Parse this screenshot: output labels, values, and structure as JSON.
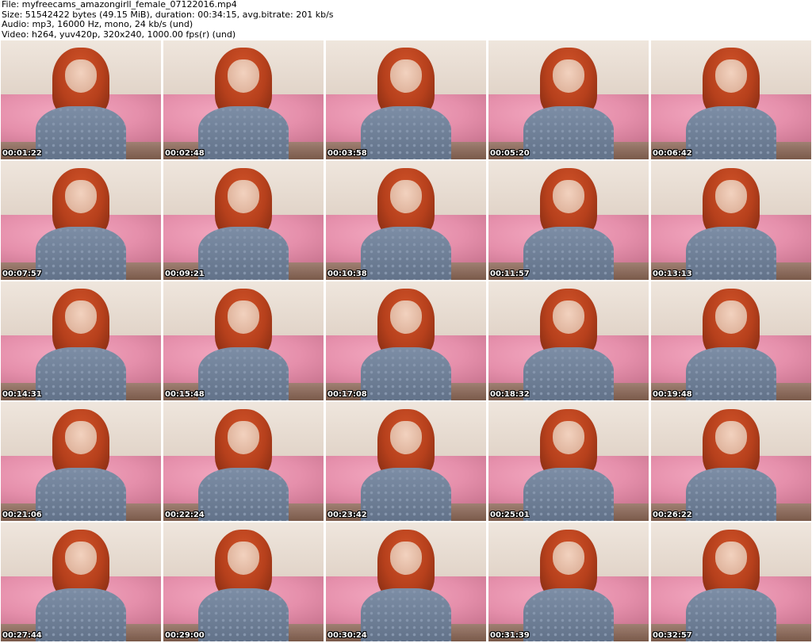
{
  "header": {
    "file_line": "File: myfreecams_amazongirll_female_07122016.mp4",
    "size_line": "Size: 51542422 bytes (49.15 MiB), duration: 00:34:15, avg.bitrate: 201 kb/s",
    "audio_line": "Audio: mp3, 16000 Hz, mono, 24 kb/s (und)",
    "video_line": "Video: h264, yuv420p, 320x240, 1000.00 fps(r) (und)"
  },
  "thumbnails": [
    {
      "timestamp": "00:01:22"
    },
    {
      "timestamp": "00:02:48"
    },
    {
      "timestamp": "00:03:58"
    },
    {
      "timestamp": "00:05:20"
    },
    {
      "timestamp": "00:06:42"
    },
    {
      "timestamp": "00:07:57"
    },
    {
      "timestamp": "00:09:21"
    },
    {
      "timestamp": "00:10:38"
    },
    {
      "timestamp": "00:11:57"
    },
    {
      "timestamp": "00:13:13"
    },
    {
      "timestamp": "00:14:31"
    },
    {
      "timestamp": "00:15:48"
    },
    {
      "timestamp": "00:17:08"
    },
    {
      "timestamp": "00:18:32"
    },
    {
      "timestamp": "00:19:48"
    },
    {
      "timestamp": "00:21:06"
    },
    {
      "timestamp": "00:22:24"
    },
    {
      "timestamp": "00:23:42"
    },
    {
      "timestamp": "00:25:01"
    },
    {
      "timestamp": "00:26:22"
    },
    {
      "timestamp": "00:27:44"
    },
    {
      "timestamp": "00:29:00"
    },
    {
      "timestamp": "00:30:24"
    },
    {
      "timestamp": "00:31:39"
    },
    {
      "timestamp": "00:32:57"
    }
  ]
}
